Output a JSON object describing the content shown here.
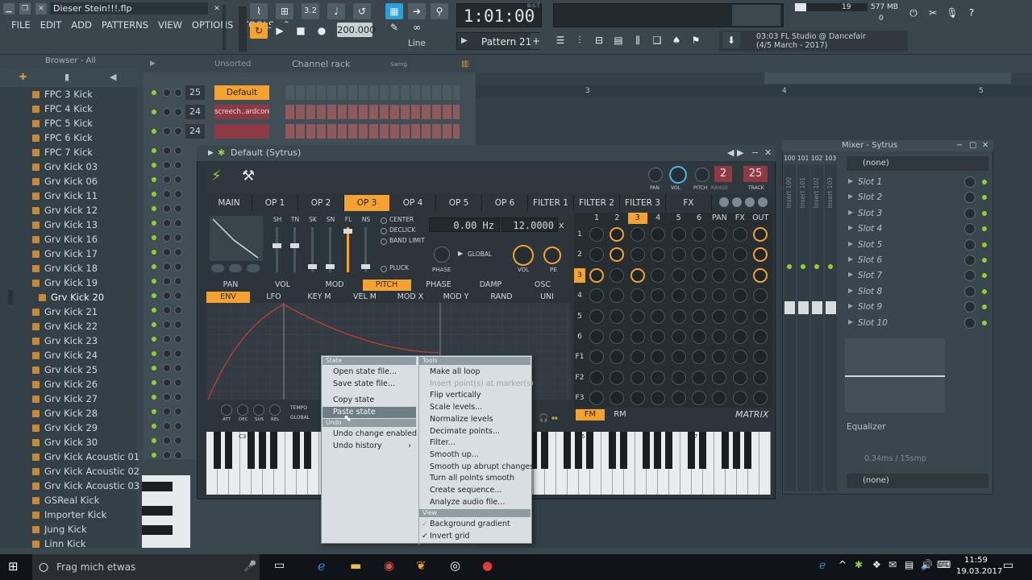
{
  "window": {
    "title": "Dieser Stein!!!.flp"
  },
  "menu": [
    "FILE",
    "EDIT",
    "ADD",
    "PATTERNS",
    "VIEW",
    "OPTIONS",
    "TOOLS",
    "?"
  ],
  "transport": {
    "time": "1:01:00",
    "time_label": "B:S:T",
    "tempo": "200.000",
    "pattern": "Pattern 21",
    "snap": "Line",
    "cpu": "19",
    "memory": "577 MB",
    "voices": "0"
  },
  "hint": {
    "line1": "03:03  FL Studio @ Dancefair",
    "line2": "(4/5 March - 2017)"
  },
  "browser": {
    "title": "Browser - All",
    "items": [
      "FPC 3 Kick",
      "FPC 4 Kick",
      "FPC 5 Kick",
      "FPC 6 Kick",
      "FPC 7 Kick",
      "Grv Kick 03",
      "Grv Kick 06",
      "Grv Kick 11",
      "Grv Kick 12",
      "Grv Kick 13",
      "Grv Kick 16",
      "Grv Kick 17",
      "Grv Kick 18",
      "Grv Kick 19",
      "Grv Kick 20",
      "Grv Kick 21",
      "Grv Kick 22",
      "Grv Kick 23",
      "Grv Kick 24",
      "Grv Kick 25",
      "Grv Kick 26",
      "Grv Kick 27",
      "Grv Kick 28",
      "Grv Kick 29",
      "Grv Kick 30",
      "Grv Kick Acoustic 01",
      "Grv Kick Acoustic 02",
      "Grv Kick Acoustic 03",
      "GSReal Kick",
      "Importer Kick",
      "Jung Kick",
      "Linn Kick"
    ],
    "selected": "Grv Kick 20"
  },
  "channel_rack": {
    "title": "Channel rack",
    "filter": "Unsorted",
    "swing_label": "Swing",
    "channels": [
      {
        "num": "25",
        "name": "Default",
        "active": true
      },
      {
        "num": "24",
        "name": "screech..ardcore",
        "active": false
      },
      {
        "num": "24",
        "name": "",
        "active": false
      }
    ]
  },
  "playlist": {
    "ruler": [
      "3",
      "4",
      "5"
    ]
  },
  "sytrus": {
    "title": "Default (Sytrus)",
    "knob_labels": [
      "PAN",
      "VOL",
      "PITCH",
      "RANGE",
      "TRACK"
    ],
    "range_value": "2",
    "track_value": "25",
    "tabs": [
      "MAIN",
      "OP 1",
      "OP 2",
      "OP 3",
      "OP 4",
      "OP 5",
      "OP 6",
      "FILTER 1",
      "FILTER 2",
      "FILTER 3",
      "FX"
    ],
    "active_tab": "OP 3",
    "filter_labels": [
      "SH",
      "TN",
      "SK",
      "SN",
      "FL",
      "NS"
    ],
    "options": [
      "CENTER",
      "DECLICK",
      "BAND LIMIT",
      "PLUCK"
    ],
    "freq": "0.00 Hz",
    "ratio": "12.0000",
    "ratio_suffix": "x",
    "phase_label": "PHASE",
    "global_label": "GLOBAL",
    "vol_label": "VOL",
    "pe_label": "PE",
    "mod_tabs": [
      "PAN",
      "VOL",
      "MOD",
      "PITCH",
      "PHASE",
      "DAMP",
      "OSC"
    ],
    "active_mod_tab": "PITCH",
    "env_tabs": [
      "ENV",
      "LFO",
      "KEY M",
      "VEL M",
      "MOD X",
      "MOD Y",
      "RAND",
      "UNI"
    ],
    "active_env_tab": "ENV",
    "env_knobs": [
      "ATT",
      "DEC",
      "SUS",
      "REL"
    ],
    "tempo_label": "TEMPO",
    "matrix": {
      "cols": [
        "1",
        "2",
        "3",
        "4",
        "5",
        "6",
        "PAN",
        "FX",
        "OUT"
      ],
      "rows": [
        "1",
        "2",
        "3",
        "4",
        "5",
        "6",
        "F1",
        "F2",
        "F3"
      ],
      "active_col": "3",
      "active_row": "3",
      "modes": [
        "FM",
        "RM"
      ],
      "active_mode": "FM",
      "label": "MATRIX"
    },
    "keyboard_labels": [
      "C3",
      "C6",
      "C7"
    ]
  },
  "context_menu": {
    "state_header": "State",
    "state_items": [
      "Open state file...",
      "Save state file...",
      "Copy state",
      "Paste state"
    ],
    "hovered": "Paste state",
    "undo_header": "Undo",
    "undo_items": [
      "Undo change enabled",
      "Undo history"
    ],
    "tools_header": "Tools",
    "tools_items": [
      {
        "label": "Make all loop",
        "disabled": false
      },
      {
        "label": "Insert point(s) at marker(s)",
        "disabled": true
      },
      {
        "label": "Flip vertically",
        "disabled": false
      },
      {
        "label": "Scale levels...",
        "disabled": false
      },
      {
        "label": "Normalize levels",
        "disabled": false
      },
      {
        "label": "Decimate points...",
        "disabled": false
      },
      {
        "label": "Filter...",
        "disabled": false
      },
      {
        "label": "Smooth up...",
        "disabled": false
      },
      {
        "label": "Smooth up abrupt changes",
        "disabled": false
      },
      {
        "label": "Turn all points smooth",
        "disabled": false
      },
      {
        "label": "Create sequence...",
        "disabled": false
      },
      {
        "label": "Analyze audio file...",
        "disabled": false
      }
    ],
    "view_header": "View",
    "view_items": [
      {
        "label": "Background gradient",
        "checked": true,
        "dim": true
      },
      {
        "label": "Invert grid",
        "checked": true,
        "dim": false
      }
    ]
  },
  "mixer": {
    "title": "Mixer - Sytrus",
    "insert_numbers": [
      "100",
      "101",
      "102",
      "103"
    ],
    "insert_labels": [
      "Insert 100",
      "Insert 101",
      "Insert 102",
      "Insert 103"
    ],
    "preset": "(none)",
    "slots": [
      "Slot 1",
      "Slot 2",
      "Slot 3",
      "Slot 4",
      "Slot 5",
      "Slot 6",
      "Slot 7",
      "Slot 8",
      "Slot 9",
      "Slot 10"
    ],
    "eq_label": "Equalizer",
    "latency": "0.34ms / 15smp",
    "bottom": "(none)"
  },
  "taskbar": {
    "search": "Frag mich etwas",
    "time": "11:59",
    "date": "19.03.2017"
  },
  "colors": {
    "accent": "#f5a231",
    "led": "#8fd12d",
    "bg": "#3b474f"
  }
}
